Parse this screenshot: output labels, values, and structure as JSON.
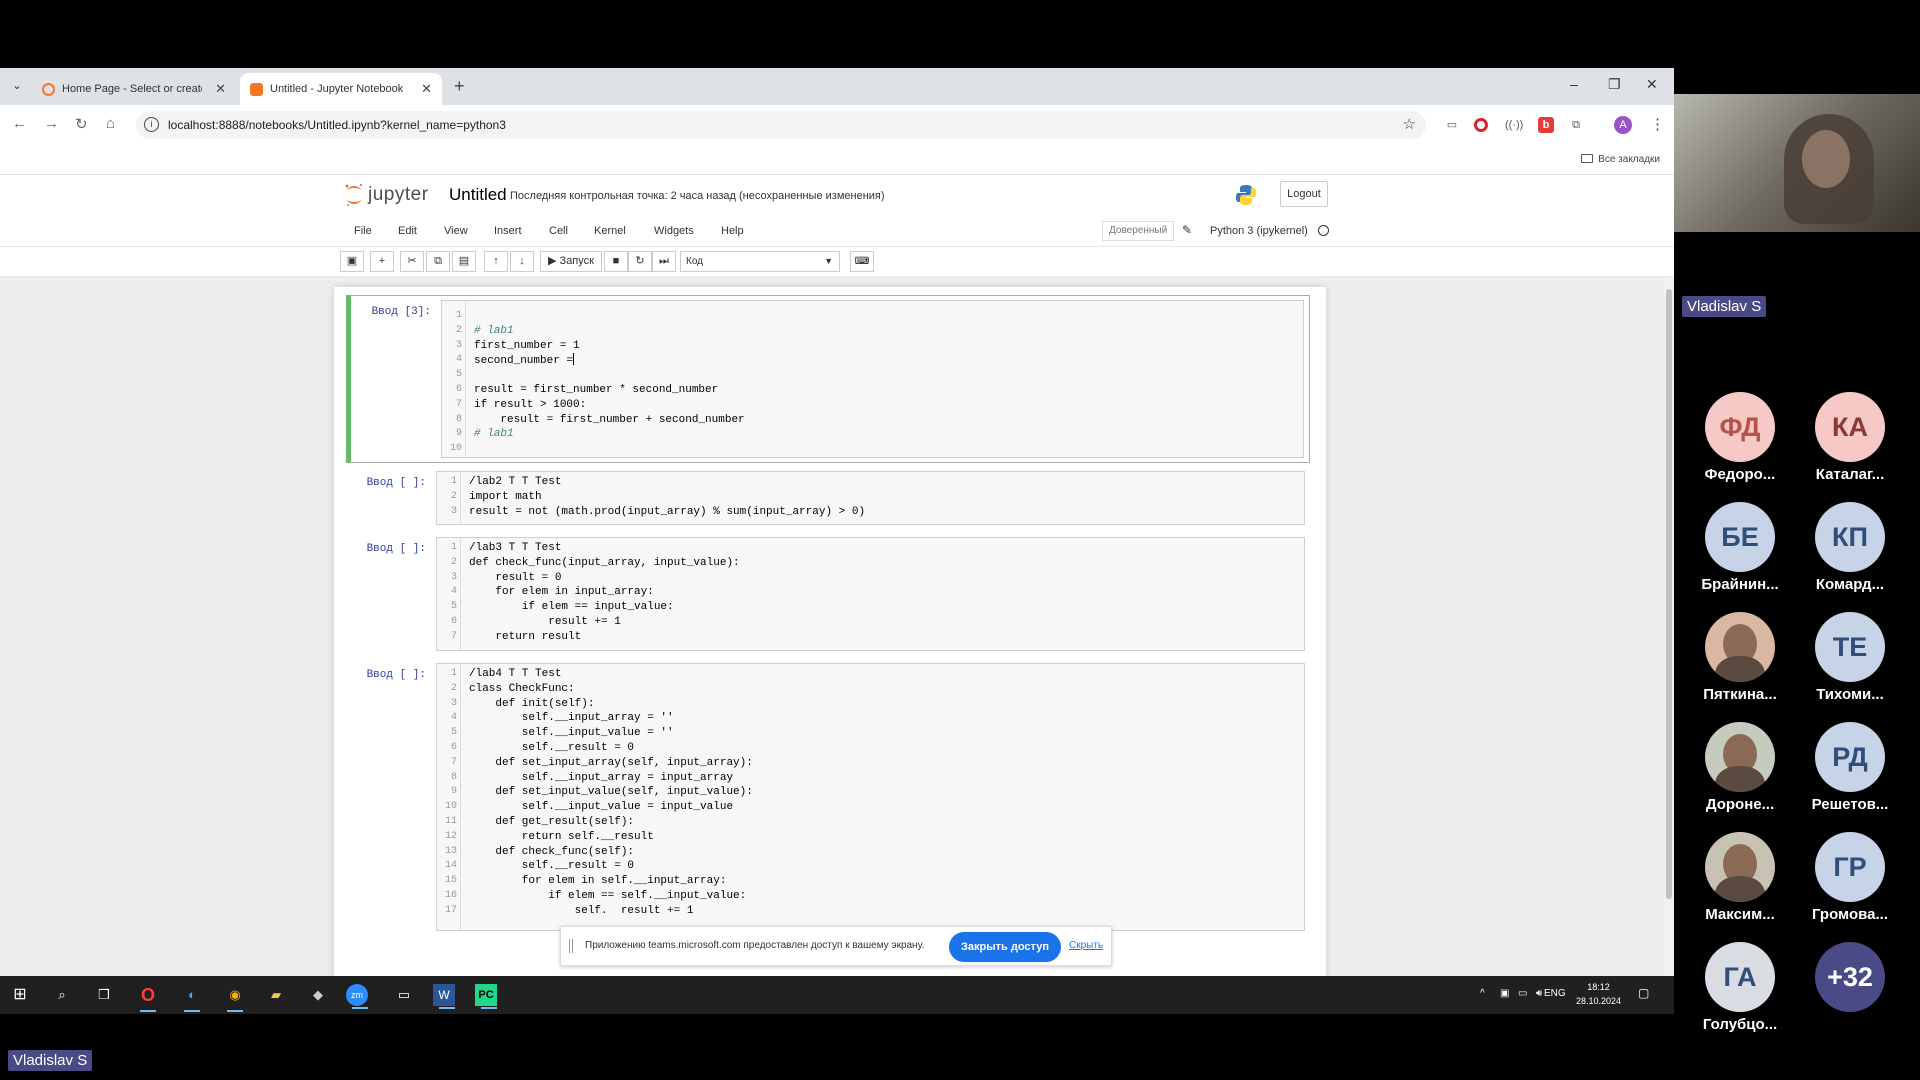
{
  "browser": {
    "tabs": [
      {
        "title": "Home Page - Select or create a",
        "active": false
      },
      {
        "title": "Untitled - Jupyter Notebook",
        "active": true
      }
    ],
    "url": "localhost:8888/notebooks/Untitled.ipynb?kernel_name=python3",
    "bookmarks_all": "Все закладки",
    "profile_initial": "A"
  },
  "jupyter": {
    "logo_text": "jupyter",
    "notebook_title": "Untitled",
    "checkpoint_text": "Последняя контрольная точка: 2 часа назад  (несохраненные изменения)",
    "logout_label": "Logout",
    "menus": [
      "File",
      "Edit",
      "View",
      "Insert",
      "Cell",
      "Kernel",
      "Widgets",
      "Help"
    ],
    "trusted_label": "Доверенный",
    "kernel_name": "Python 3 (ipykernel)",
    "run_label": "Запуск",
    "cell_type": "Код"
  },
  "cells": [
    {
      "prompt": "Ввод [3]:",
      "lines": [
        "",
        "# lab1",
        "first_number = 1",
        "second_number =",
        "",
        "result = first_number * second_number",
        "if result > 1000:",
        "    result = first_number + second_number",
        "# lab1",
        ""
      ]
    },
    {
      "prompt": "Ввод [ ]:",
      "lines": [
        "/lab2 T T Test",
        "import math",
        "result = not (math.prod(input_array) % sum(input_array) > 0)"
      ]
    },
    {
      "prompt": "Ввод [ ]:",
      "lines": [
        "/lab3 T T Test",
        "def check_func(input_array, input_value):",
        "    result = 0",
        "    for elem in input_array:",
        "        if elem == input_value:",
        "            result += 1",
        "    return result"
      ]
    },
    {
      "prompt": "Ввод [ ]:",
      "lines": [
        "/lab4 T T Test",
        "class CheckFunc:",
        "    def init(self):",
        "        self.__input_array = ''",
        "        self.__input_value = ''",
        "        self.__result = 0",
        "    def set_input_array(self, input_array):",
        "        self.__input_array = input_array",
        "    def set_input_value(self, input_value):",
        "        self.__input_value = input_value",
        "    def get_result(self):",
        "        return self.__result",
        "    def check_func(self):",
        "        self.__result = 0",
        "        for elem in self.__input_array:",
        "            if elem == self.__input_value:",
        "                self.  result += 1"
      ]
    }
  ],
  "share_banner": {
    "message": "Приложению teams.microsoft.com предоставлен доступ к вашему экрану.",
    "stop_label": "Закрыть доступ",
    "hide_label": "Скрыть"
  },
  "taskbar": {
    "lang": "ENG",
    "time": "18:12",
    "date": "28.10.2024"
  },
  "meeting": {
    "presenter_name": "Vladislav S",
    "self_name": "Vladislav S",
    "participants": [
      {
        "initials": "ФД",
        "name": "Федоро...",
        "color": "#f6c9c6",
        "text_color": "#b4534c"
      },
      {
        "initials": "КА",
        "name": "Каталаг...",
        "color": "#f6c9c6",
        "text_color": "#8a3a36"
      },
      {
        "initials": "БЕ",
        "name": "Брайнин...",
        "color": "#c7d3e6",
        "text_color": "#2f4e7a"
      },
      {
        "initials": "КП",
        "name": "Комард...",
        "color": "#c7d3e6",
        "text_color": "#2f4e7a"
      },
      {
        "initials": "",
        "name": "Пяткина...",
        "color": "#d9b7a2",
        "text_color": "#fff",
        "photo": true
      },
      {
        "initials": "ТЕ",
        "name": "Тихоми...",
        "color": "#c7d3e6",
        "text_color": "#2f4e7a"
      },
      {
        "initials": "",
        "name": "Дороне...",
        "color": "#c6cbbf",
        "text_color": "#fff",
        "photo": true
      },
      {
        "initials": "РД",
        "name": "Решетов...",
        "color": "#c7d3e6",
        "text_color": "#2f4e7a"
      },
      {
        "initials": "",
        "name": "Максим...",
        "color": "#c8c2b3",
        "text_color": "#fff",
        "photo": true
      },
      {
        "initials": "ГР",
        "name": "Громова...",
        "color": "#c7d3e6",
        "text_color": "#2f4e7a"
      },
      {
        "initials": "ГА",
        "name": "Голубцо...",
        "color": "#d9dde3",
        "text_color": "#2f4e7a"
      },
      {
        "initials": "+32",
        "name": "",
        "color": "#4a4a86",
        "text_color": "#fff"
      }
    ]
  }
}
